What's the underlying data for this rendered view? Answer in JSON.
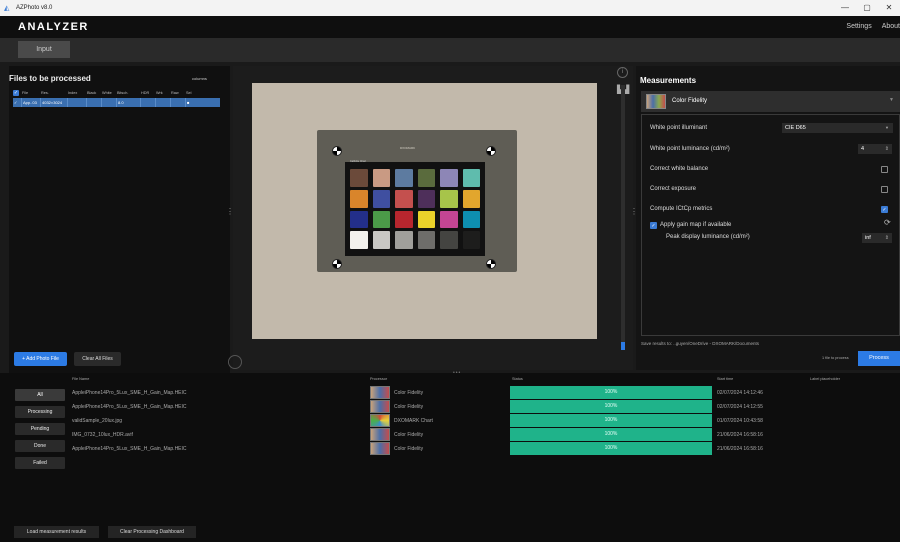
{
  "window": {
    "title": "AZPhoto v8.0",
    "controls": [
      "—",
      "▢",
      "✕"
    ]
  },
  "appbar": {
    "logo": "ANALYZER",
    "nav": [
      "Settings",
      "About"
    ]
  },
  "inputbar": {
    "input_label": "Input"
  },
  "files_panel": {
    "title": "Files to be processed",
    "columns_link": "columns",
    "headers": [
      "",
      "File",
      "Res.",
      "Index",
      "Black",
      "White",
      "Bitsch.",
      "HDR",
      "Wrk",
      "Raw",
      "Sel"
    ],
    "row": [
      "✓",
      "App..03",
      "4032×3024",
      "",
      "",
      "",
      "8.0",
      "",
      "",
      "",
      "■"
    ],
    "add_button": "+ Add Photo File",
    "clear_button": "Clear All Files"
  },
  "viewer": {
    "board_brand": "DXOMARK",
    "chart_tag": "Calibrite Chart",
    "patches": [
      "#6b4a3a",
      "#c99a83",
      "#5d7ba0",
      "#5a6b3d",
      "#8d86b6",
      "#5fbcad",
      "#d9852b",
      "#3f4fa0",
      "#c4504e",
      "#4e2f5a",
      "#a7c44a",
      "#e2a62d",
      "#232f8a",
      "#4b9a48",
      "#b7262e",
      "#ebd22a",
      "#c34593",
      "#0e8fb0",
      "#f2f1ec",
      "#c9c8c4",
      "#a09f9b",
      "#6e6d6a",
      "#444441",
      "#1d1d1c"
    ]
  },
  "measurements": {
    "title": "Measurements",
    "selected": "Color Fidelity",
    "white_point_label": "White point illuminant",
    "white_point_value": "CIE D65",
    "luminance_label": "White point luminance (cd/m²)",
    "luminance_value": "4",
    "correct_wb_label": "Correct white balance",
    "correct_exposure_label": "Correct exposure",
    "ictcp_label": "Compute ICtCp metrics",
    "gain_map_label": "Apply gain map if available",
    "peak_label": "Peak display luminance (cd/m²)",
    "peak_value": "inf",
    "save_text": "Save results to:   ..guyen/OneDrive - DXOMARK/Documents",
    "count_text": "1 file to process",
    "process_button": "Process"
  },
  "dashboard": {
    "headers": {
      "file_name": "File Name",
      "protocol": "Processor",
      "status": "Status",
      "start_time": "Start time",
      "label": "Label placeholder"
    },
    "filters": [
      "All",
      "Processing",
      "Pending",
      "Done",
      "Failed"
    ],
    "rows": [
      {
        "file": "AppleiPhone14Pro_5Lux_SME_H_Gain_Map.HEIC",
        "protocol": "Color Fidelity",
        "status": "100%",
        "start": "02/07/2024 14:12:46"
      },
      {
        "file": "AppleiPhone14Pro_5Lux_SME_H_Gain_Map.HEIC",
        "protocol": "Color Fidelity",
        "status": "100%",
        "start": "02/07/2024 14:12:55"
      },
      {
        "file": "validSample_20lux.jpg",
        "protocol": "DXOMARK Chart",
        "status": "100%",
        "start": "01/07/2024 10:43:58"
      },
      {
        "file": "IMG_0732_10lux_HDR.avif",
        "protocol": "Color Fidelity",
        "status": "100%",
        "start": "21/06/2024 16:58:16"
      },
      {
        "file": "AppleiPhone14Pro_5Lux_SME_H_Gain_Map.HEIC",
        "protocol": "Color Fidelity",
        "status": "100%",
        "start": "21/06/2024 16:58:16"
      }
    ],
    "load_button": "Load measurement results",
    "clear_button": "Clear Processing Dashboard"
  }
}
